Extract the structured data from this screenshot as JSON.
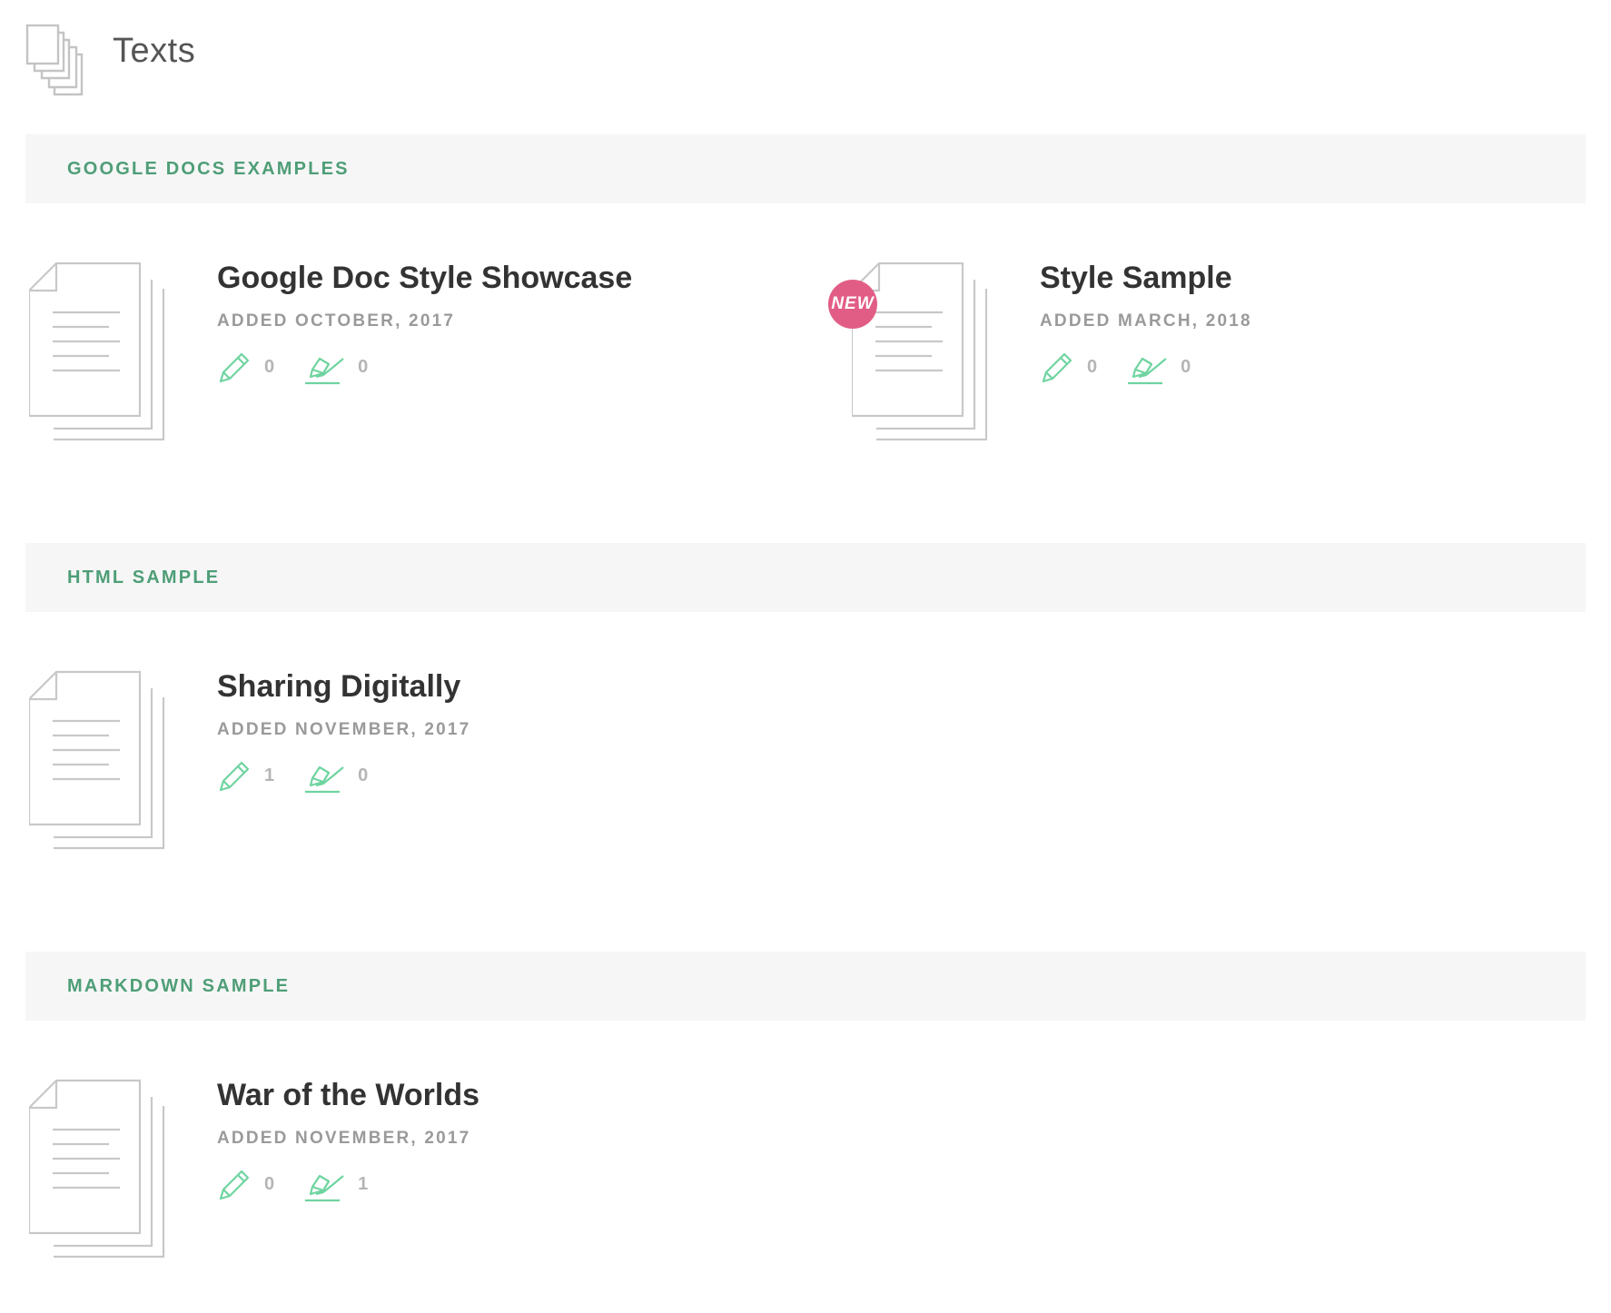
{
  "page": {
    "title": "Texts",
    "icon": "stacked-documents-icon"
  },
  "colors": {
    "section_title": "#4e9e77",
    "section_bg": "#f6f6f6",
    "stat_icon": "#6fd4a0",
    "new_badge": "#e25d86",
    "muted_text": "#9a9a9a"
  },
  "sections": [
    {
      "title": "GOOGLE DOCS EXAMPLES",
      "items": [
        {
          "title": "Google Doc Style Showcase",
          "date": "ADDED OCTOBER, 2017",
          "edits": "0",
          "highlights": "0",
          "is_new": false
        },
        {
          "title": "Style Sample",
          "date": "ADDED MARCH, 2018",
          "edits": "0",
          "highlights": "0",
          "is_new": true,
          "badge": "NEW"
        }
      ]
    },
    {
      "title": "HTML SAMPLE",
      "items": [
        {
          "title": "Sharing Digitally",
          "date": "ADDED NOVEMBER, 2017",
          "edits": "1",
          "highlights": "0",
          "is_new": false
        }
      ]
    },
    {
      "title": "MARKDOWN SAMPLE",
      "items": [
        {
          "title": "War of the Worlds",
          "date": "ADDED NOVEMBER, 2017",
          "edits": "0",
          "highlights": "1",
          "is_new": false
        }
      ]
    }
  ]
}
